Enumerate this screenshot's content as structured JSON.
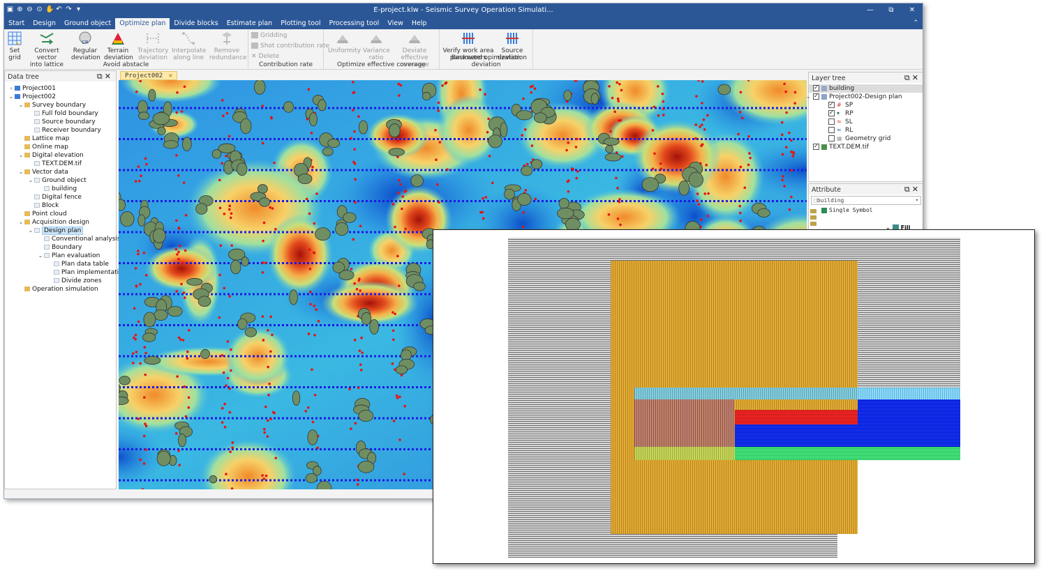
{
  "window": {
    "title": "E-project.klw - Seismic Survey Operation Simulati...",
    "controls": [
      "—",
      "⧉",
      "✕"
    ]
  },
  "menu_tabs": [
    {
      "label": "Start"
    },
    {
      "label": "Design"
    },
    {
      "label": "Ground object"
    },
    {
      "label": "Optimize plan",
      "active": true
    },
    {
      "label": "Divide blocks"
    },
    {
      "label": "Estimate plan"
    },
    {
      "label": "Plotting tool"
    },
    {
      "label": "Processing tool"
    },
    {
      "label": "View"
    },
    {
      "label": "Help"
    }
  ],
  "ribbon": {
    "avoid_obstacle": {
      "group_label": "Avoid abstacle",
      "buttons": [
        {
          "line1": "Set",
          "line2": "grid",
          "icon": "grid-icon",
          "enabled": true
        },
        {
          "line1": "Convert vector",
          "line2": "into lattice",
          "icon": "convert-icon",
          "enabled": true
        },
        {
          "line1": "Regular",
          "line2": "deviation",
          "icon": "regular-deviation-icon",
          "enabled": true
        },
        {
          "line1": "Terrain",
          "line2": "deviation",
          "icon": "terrain-deviation-icon",
          "enabled": true
        },
        {
          "line1": "Trajectory",
          "line2": "deviation",
          "icon": "trajectory-icon",
          "enabled": false
        },
        {
          "line1": "Interpolate",
          "line2": "along line",
          "icon": "interpolate-icon",
          "enabled": false
        },
        {
          "line1": "Remove",
          "line2": "redundance",
          "icon": "remove-icon",
          "enabled": false
        }
      ]
    },
    "contribution_rate": {
      "group_label": "Contribution rate",
      "items": [
        "Gridding",
        "Shot contribution rate",
        "Delete"
      ]
    },
    "optimize_coverage": {
      "group_label": "Optimize effective coverage",
      "buttons": [
        {
          "line1": "Uniformity",
          "line2": ""
        },
        {
          "line1": "Variance",
          "line2": "ratio"
        },
        {
          "line1": "Deviate effective",
          "line2": "coverage"
        }
      ]
    },
    "backward": {
      "group_label": "Backward opimization deviation",
      "buttons": [
        {
          "line1": "Verify work area",
          "line2": "parameters"
        },
        {
          "line1": "Source",
          "line2": "deviation"
        }
      ]
    }
  },
  "data_tree": {
    "title": "Data tree",
    "items": [
      {
        "label": "Project001",
        "depth": 0,
        "arrow": "›",
        "icon": "proj"
      },
      {
        "label": "Project002",
        "depth": 0,
        "arrow": "⌄",
        "icon": "proj"
      },
      {
        "label": "Survey boundary",
        "depth": 1,
        "arrow": "⌄",
        "icon": "folder"
      },
      {
        "label": "Full fold boundary",
        "depth": 2,
        "arrow": "",
        "icon": "doc"
      },
      {
        "label": "Source boundary",
        "depth": 2,
        "arrow": "",
        "icon": "doc"
      },
      {
        "label": "Receiver boundary",
        "depth": 2,
        "arrow": "",
        "icon": "doc"
      },
      {
        "label": "Lattice map",
        "depth": 1,
        "arrow": "",
        "icon": "folder"
      },
      {
        "label": "Online map",
        "depth": 1,
        "arrow": "",
        "icon": "folder"
      },
      {
        "label": "Digital elevation",
        "depth": 1,
        "arrow": "⌄",
        "icon": "folder"
      },
      {
        "label": "TEXT.DEM.tif",
        "depth": 2,
        "arrow": "",
        "icon": "doc"
      },
      {
        "label": "Vector data",
        "depth": 1,
        "arrow": "⌄",
        "icon": "folder"
      },
      {
        "label": "Ground object",
        "depth": 2,
        "arrow": "⌄",
        "icon": "doc"
      },
      {
        "label": "building",
        "depth": 3,
        "arrow": "",
        "icon": "doc"
      },
      {
        "label": "Digital fence",
        "depth": 2,
        "arrow": "",
        "icon": "doc"
      },
      {
        "label": "Block",
        "depth": 2,
        "arrow": "",
        "icon": "doc"
      },
      {
        "label": "Point cloud",
        "depth": 1,
        "arrow": "",
        "icon": "folder"
      },
      {
        "label": "Acquisition design",
        "depth": 1,
        "arrow": "⌄",
        "icon": "folder"
      },
      {
        "label": "Design plan",
        "depth": 2,
        "arrow": "⌄",
        "icon": "doc",
        "selected": true
      },
      {
        "label": "Conventional analysis",
        "depth": 3,
        "arrow": "",
        "icon": "doc"
      },
      {
        "label": "Boundary",
        "depth": 3,
        "arrow": "",
        "icon": "doc"
      },
      {
        "label": "Plan evaluation",
        "depth": 3,
        "arrow": "⌄",
        "icon": "doc"
      },
      {
        "label": "Plan data table",
        "depth": 4,
        "arrow": "",
        "icon": "doc"
      },
      {
        "label": "Plan implementati...",
        "depth": 4,
        "arrow": "",
        "icon": "doc"
      },
      {
        "label": "Divide zones",
        "depth": 4,
        "arrow": "",
        "icon": "doc"
      },
      {
        "label": "Operation simulation",
        "depth": 1,
        "arrow": "",
        "icon": "folder"
      }
    ]
  },
  "document": {
    "tab_label": "Project002",
    "close_glyph": "✕"
  },
  "layer_tree": {
    "title": "Layer tree",
    "items": [
      {
        "label": "building",
        "depth": 0,
        "checked": true,
        "selected": true,
        "color": "#9aa9c9"
      },
      {
        "label": "Project002-Design plan",
        "depth": 0,
        "checked": true,
        "arrow": "⌄",
        "color": "#8ea3c8"
      },
      {
        "label": "SP",
        "depth": 1,
        "checked": true,
        "color": "#d9342b",
        "glyph": "#"
      },
      {
        "label": "RP",
        "depth": 1,
        "checked": true,
        "color": "#1e7a3e",
        "glyph": "▾"
      },
      {
        "label": "SL",
        "depth": 1,
        "checked": false,
        "color": "#d9342b",
        "glyph": "≈"
      },
      {
        "label": "RL",
        "depth": 1,
        "checked": false,
        "color": "#2a5db0",
        "glyph": "≈"
      },
      {
        "label": "Geometry grid",
        "depth": 1,
        "checked": false,
        "color": "#9aa0a8",
        "glyph": "▦"
      },
      {
        "label": "TEXT.DEM.tif",
        "depth": 0,
        "checked": true,
        "color": "#4a8f4a"
      }
    ]
  },
  "attribute": {
    "title": "Attribute",
    "layer_select": "building",
    "symbol_mode": "Single Symbol",
    "fill_label": "Fill"
  }
}
